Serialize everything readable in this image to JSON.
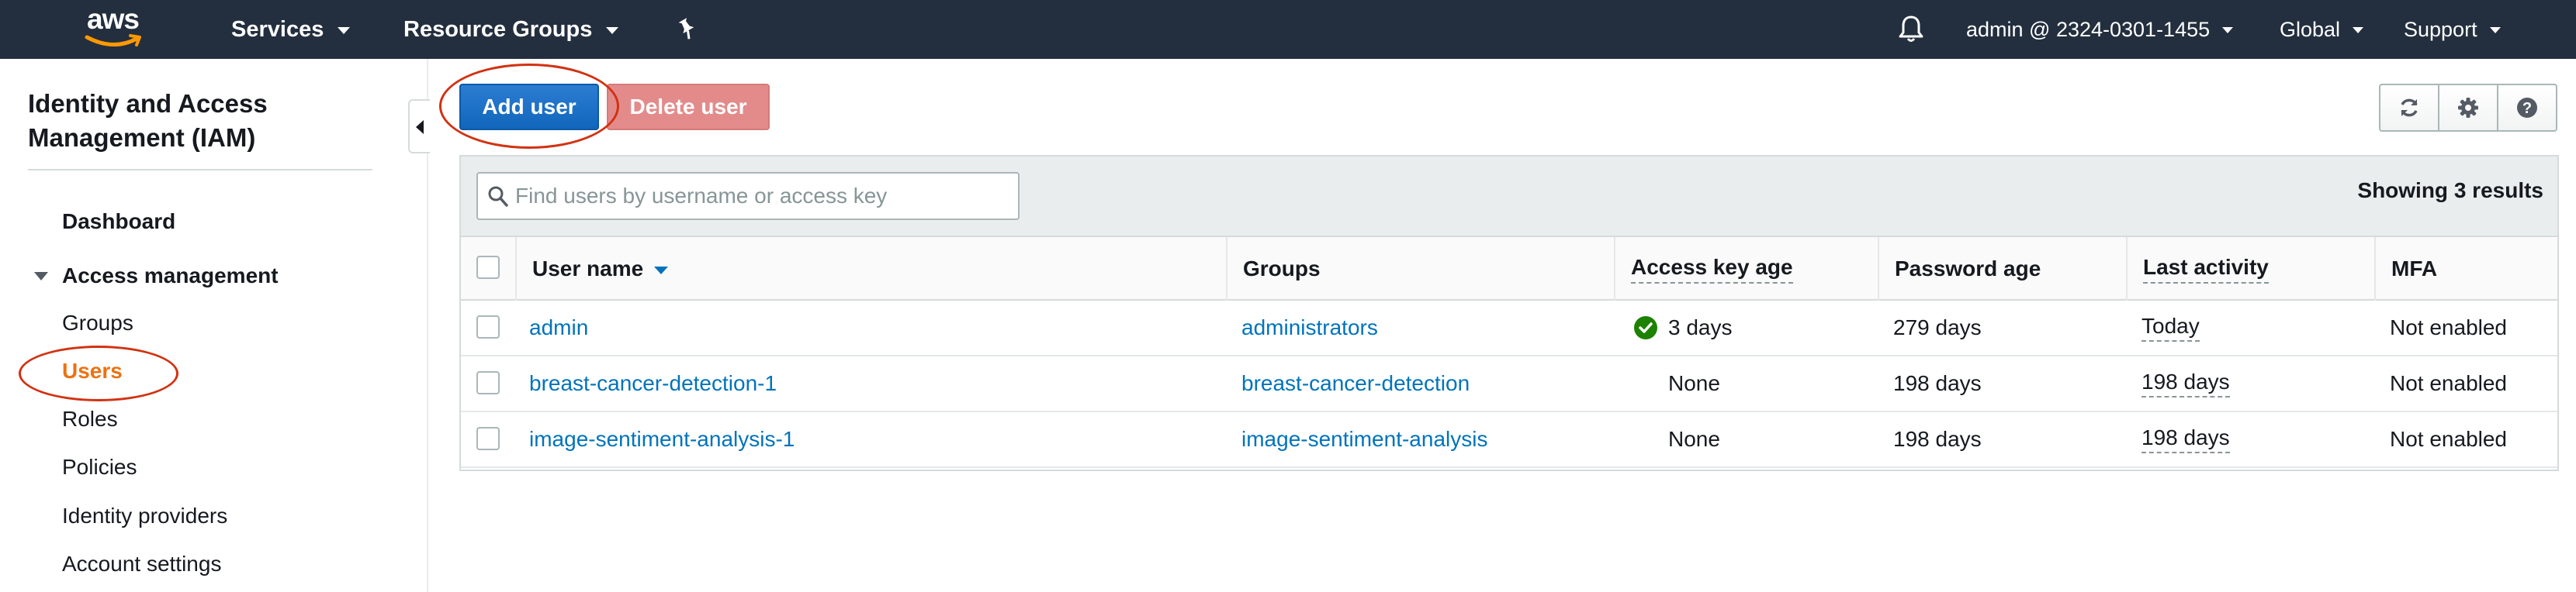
{
  "nav": {
    "logo_text": "aws",
    "services_label": "Services",
    "resource_groups_label": "Resource Groups",
    "account_label": "admin @ 2324-0301-1455",
    "region_label": "Global",
    "support_label": "Support"
  },
  "sidebar": {
    "title": "Identity and Access Management (IAM)",
    "dashboard_label": "Dashboard",
    "section_label": "Access management",
    "items": [
      {
        "label": "Groups",
        "active": false
      },
      {
        "label": "Users",
        "active": true
      },
      {
        "label": "Roles",
        "active": false
      },
      {
        "label": "Policies",
        "active": false
      },
      {
        "label": "Identity providers",
        "active": false
      },
      {
        "label": "Account settings",
        "active": false
      }
    ]
  },
  "toolbar": {
    "add_user_label": "Add user",
    "delete_user_label": "Delete user"
  },
  "table": {
    "search_placeholder": "Find users by username or access key",
    "results_label": "Showing 3 results",
    "columns": [
      "User name",
      "Groups",
      "Access key age",
      "Password age",
      "Last activity",
      "MFA"
    ],
    "rows": [
      {
        "user": "admin",
        "groups": "administrators",
        "access_key_age": "3 days",
        "access_key_ok": true,
        "password_age": "279 days",
        "last_activity": "Today",
        "mfa": "Not enabled"
      },
      {
        "user": "breast-cancer-detection-1",
        "groups": "breast-cancer-detection",
        "access_key_age": "None",
        "access_key_ok": false,
        "password_age": "198 days",
        "last_activity": "198 days",
        "mfa": "Not enabled"
      },
      {
        "user": "image-sentiment-analysis-1",
        "groups": "image-sentiment-analysis",
        "access_key_age": "None",
        "access_key_ok": false,
        "password_age": "198 days",
        "last_activity": "198 days",
        "mfa": "Not enabled"
      }
    ]
  },
  "colors": {
    "nav_bg": "#232f3e",
    "primary_button": "#1166bb",
    "active_link": "#ec7211",
    "link": "#0073bb",
    "annotation": "#d13212",
    "success": "#1d8102"
  }
}
